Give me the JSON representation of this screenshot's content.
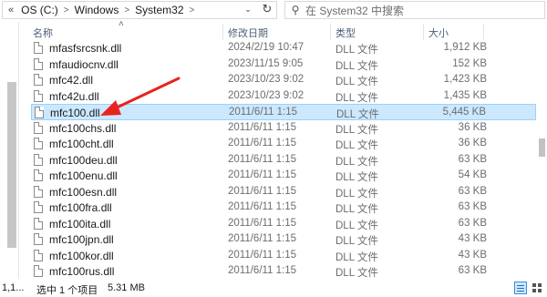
{
  "address": {
    "back_chevron": "«",
    "segments": [
      "OS (C:)",
      "Windows",
      "System32"
    ],
    "separator": ">"
  },
  "search": {
    "placeholder": "在 System32 中搜索"
  },
  "columns": {
    "name": "名称",
    "date": "修改日期",
    "type": "类型",
    "size": "大小"
  },
  "files": [
    {
      "name": "mfasfsrcsnk.dll",
      "date": "2024/2/19 10:47",
      "type": "DLL 文件",
      "size": "1,912 KB",
      "selected": false
    },
    {
      "name": "mfaudiocnv.dll",
      "date": "2023/11/15 9:05",
      "type": "DLL 文件",
      "size": "152 KB",
      "selected": false
    },
    {
      "name": "mfc42.dll",
      "date": "2023/10/23 9:02",
      "type": "DLL 文件",
      "size": "1,423 KB",
      "selected": false
    },
    {
      "name": "mfc42u.dll",
      "date": "2023/10/23 9:02",
      "type": "DLL 文件",
      "size": "1,435 KB",
      "selected": false
    },
    {
      "name": "mfc100.dll",
      "date": "2011/6/11 1:15",
      "type": "DLL 文件",
      "size": "5,445 KB",
      "selected": true
    },
    {
      "name": "mfc100chs.dll",
      "date": "2011/6/11 1:15",
      "type": "DLL 文件",
      "size": "36 KB",
      "selected": false
    },
    {
      "name": "mfc100cht.dll",
      "date": "2011/6/11 1:15",
      "type": "DLL 文件",
      "size": "36 KB",
      "selected": false
    },
    {
      "name": "mfc100deu.dll",
      "date": "2011/6/11 1:15",
      "type": "DLL 文件",
      "size": "63 KB",
      "selected": false
    },
    {
      "name": "mfc100enu.dll",
      "date": "2011/6/11 1:15",
      "type": "DLL 文件",
      "size": "54 KB",
      "selected": false
    },
    {
      "name": "mfc100esn.dll",
      "date": "2011/6/11 1:15",
      "type": "DLL 文件",
      "size": "63 KB",
      "selected": false
    },
    {
      "name": "mfc100fra.dll",
      "date": "2011/6/11 1:15",
      "type": "DLL 文件",
      "size": "63 KB",
      "selected": false
    },
    {
      "name": "mfc100ita.dll",
      "date": "2011/6/11 1:15",
      "type": "DLL 文件",
      "size": "63 KB",
      "selected": false
    },
    {
      "name": "mfc100jpn.dll",
      "date": "2011/6/11 1:15",
      "type": "DLL 文件",
      "size": "43 KB",
      "selected": false
    },
    {
      "name": "mfc100kor.dll",
      "date": "2011/6/11 1:15",
      "type": "DLL 文件",
      "size": "43 KB",
      "selected": false
    },
    {
      "name": "mfc100rus.dll",
      "date": "2011/6/11 1:15",
      "type": "DLL 文件",
      "size": "63 KB",
      "selected": false
    }
  ],
  "status": {
    "count": "1,1...",
    "selected": "选中 1 个项目",
    "size": "5.31 MB"
  },
  "colors": {
    "selection_bg": "#cce8ff",
    "selection_border": "#99d1ff",
    "arrow": "#e8231e"
  }
}
